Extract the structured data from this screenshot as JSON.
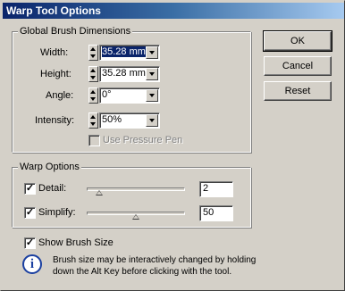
{
  "window": {
    "title": "Warp Tool Options"
  },
  "buttons": {
    "ok": "OK",
    "cancel": "Cancel",
    "reset": "Reset"
  },
  "brush_group": {
    "legend": "Global Brush Dimensions",
    "width": {
      "label": "Width:",
      "value": "35.28 mm"
    },
    "height": {
      "label": "Height:",
      "value": "35.28 mm"
    },
    "angle": {
      "label": "Angle:",
      "value": "0°"
    },
    "intensity": {
      "label": "Intensity:",
      "value": "50%"
    },
    "use_pressure_pen": {
      "label": "Use Pressure Pen",
      "checked": false,
      "enabled": false
    }
  },
  "warp_group": {
    "legend": "Warp Options",
    "detail": {
      "label": "Detail:",
      "checked": true,
      "value": "2",
      "slider_fraction": 0.13
    },
    "simplify": {
      "label": "Simplify:",
      "checked": true,
      "value": "50",
      "slider_fraction": 0.5
    }
  },
  "show_brush_size": {
    "label": "Show Brush Size",
    "checked": true
  },
  "info": {
    "icon": "info-icon",
    "text_line1": "Brush size may be interactively changed by holding",
    "text_line2": "down the Alt Key before clicking with the tool."
  },
  "colors": {
    "title_start": "#0a246a",
    "title_end": "#a6caf0",
    "face": "#d4d0c8"
  }
}
